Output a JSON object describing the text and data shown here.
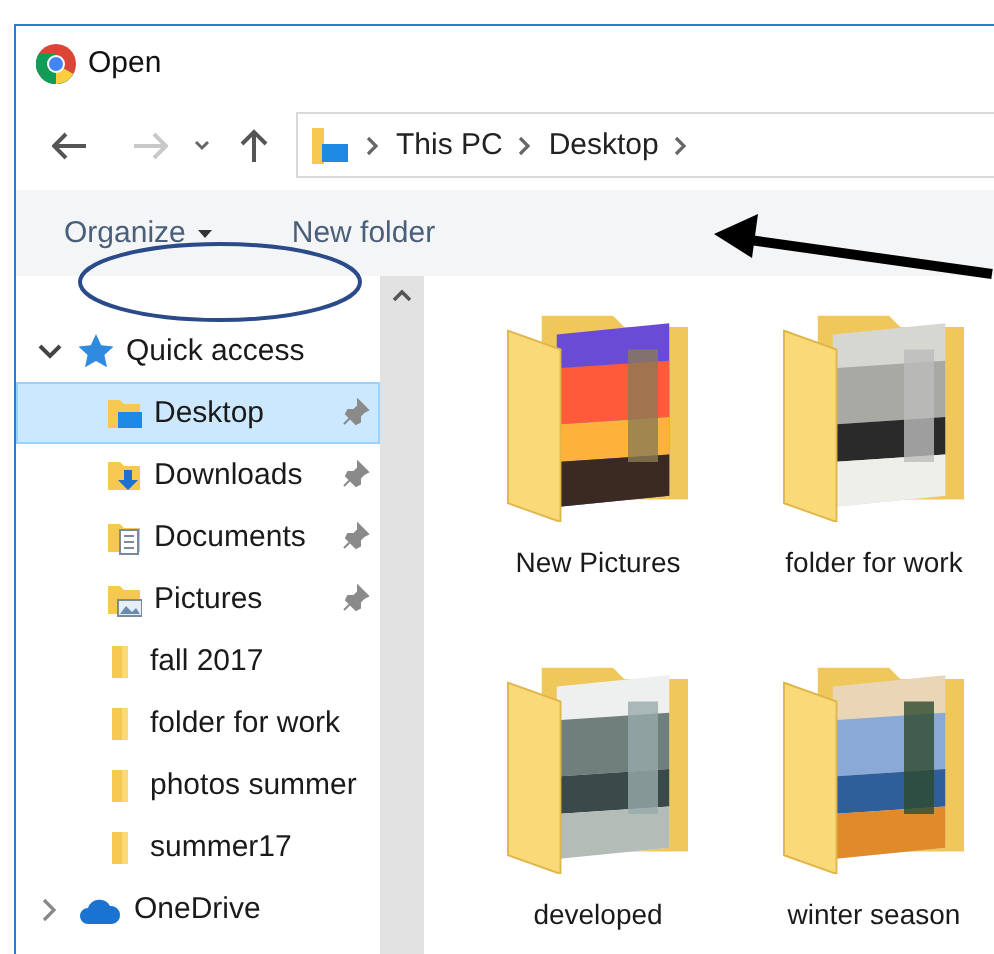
{
  "window": {
    "title": "Open"
  },
  "breadcrumb": [
    "This PC",
    "Desktop"
  ],
  "toolbar": [
    {
      "label": "Organize",
      "kind": "menu"
    },
    {
      "label": "New folder",
      "kind": "button"
    }
  ],
  "sidebar": {
    "items": [
      {
        "label": "Quick access",
        "kind": "quick",
        "expanded": true,
        "selected": false,
        "children": [
          {
            "label": "Desktop",
            "kind": "desktop",
            "selected": true,
            "pinned": true
          },
          {
            "label": "Downloads",
            "kind": "downloads",
            "selected": false,
            "pinned": true
          },
          {
            "label": "Documents",
            "kind": "documents",
            "selected": false,
            "pinned": true
          },
          {
            "label": "Pictures",
            "kind": "pictures",
            "selected": false,
            "pinned": true
          },
          {
            "label": "fall 2017",
            "kind": "folder",
            "selected": false,
            "pinned": false
          },
          {
            "label": "folder for work",
            "kind": "folder",
            "selected": false,
            "pinned": false
          },
          {
            "label": "photos summer",
            "kind": "folder",
            "selected": false,
            "pinned": false
          },
          {
            "label": "summer17",
            "kind": "folder",
            "selected": false,
            "pinned": false
          }
        ]
      },
      {
        "label": "OneDrive",
        "kind": "cloud",
        "expanded": false,
        "selected": false
      }
    ]
  },
  "folders": [
    {
      "name": "New Pictures"
    },
    {
      "name": "folder for work"
    },
    {
      "name": "developed"
    },
    {
      "name": "winter season"
    }
  ]
}
